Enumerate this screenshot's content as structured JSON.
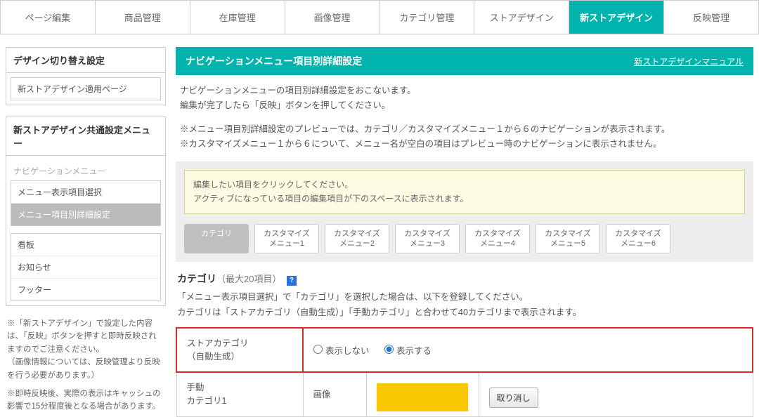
{
  "topnav": {
    "items": [
      {
        "label": "ページ編集",
        "active": false
      },
      {
        "label": "商品管理",
        "active": false
      },
      {
        "label": "在庫管理",
        "active": false
      },
      {
        "label": "画像管理",
        "active": false
      },
      {
        "label": "カテゴリ管理",
        "active": false
      },
      {
        "label": "ストアデザイン",
        "active": false
      },
      {
        "label": "新ストアデザイン",
        "active": true
      },
      {
        "label": "反映管理",
        "active": false
      }
    ]
  },
  "sidebar": {
    "section1": {
      "heading": "デザイン切り替え設定",
      "items": [
        {
          "label": "新ストアデザイン適用ページ"
        }
      ]
    },
    "section2": {
      "heading": "新ストアデザイン共通設定メニュー",
      "sublabel": "ナビゲーションメニュー",
      "group1": [
        {
          "label": "メニュー表示項目選択",
          "active": false
        },
        {
          "label": "メニュー項目別詳細設定",
          "active": true
        }
      ],
      "group2": [
        {
          "label": "看板"
        },
        {
          "label": "お知らせ"
        },
        {
          "label": "フッター"
        }
      ]
    },
    "note1": "※「新ストアデザイン」で設定した内容は、「反映」ボタンを押すと即時反映されますのでご注意ください。\n（画像情報については、反映管理より反映を行う必要があります。）",
    "note2": "※即時反映後、実際の表示はキャッシュの影響で15分程度後となる場合があります。"
  },
  "main": {
    "title": "ナビゲーションメニュー項目別詳細設定",
    "manual_link": "新ストアデザインマニュアル",
    "intro1": "ナビゲーションメニューの項目別詳細設定をおこないます。\n編集が完了したら「反映」ボタンを押してください。",
    "intro2": "※メニュー項目別詳細設定のプレビューでは、カテゴリ／カスタマイズメニュー１から６のナビゲーションが表示されます。\n※カスタマイズメニュー１から６について、メニュー名が空白の項目はプレビュー時のナビゲーションに表示されません。",
    "edit_info": "編集したい項目をクリックしてください。\nアクティブになっている項目の編集項目が下のスペースに表示されます。",
    "tabs": [
      {
        "label": "カテゴリ",
        "active": true
      },
      {
        "label": "カスタマイズ\nメニュー1"
      },
      {
        "label": "カスタマイズ\nメニュー2"
      },
      {
        "label": "カスタマイズ\nメニュー3"
      },
      {
        "label": "カスタマイズ\nメニュー4"
      },
      {
        "label": "カスタマイズ\nメニュー5"
      },
      {
        "label": "カスタマイズ\nメニュー6"
      }
    ],
    "category": {
      "title_bold": "カテゴリ",
      "title_sub": "（最大20項目）",
      "help": "?",
      "desc": "「メニュー表示項目選択」で「カテゴリ」を選択した場合は、以下を登録してください。\nカテゴリは「ストアカテゴリ（自動生成）」「手動カテゴリ」と合わせて40カテゴリまで表示されます。",
      "row1_label": "ストアカテゴリ\n（自動生成）",
      "row1_opt_hide": "表示しない",
      "row1_opt_show": "表示する",
      "row2_label": "手動\nカテゴリ1",
      "row2_col2": "画像",
      "row2_reset": "取り消し"
    }
  }
}
